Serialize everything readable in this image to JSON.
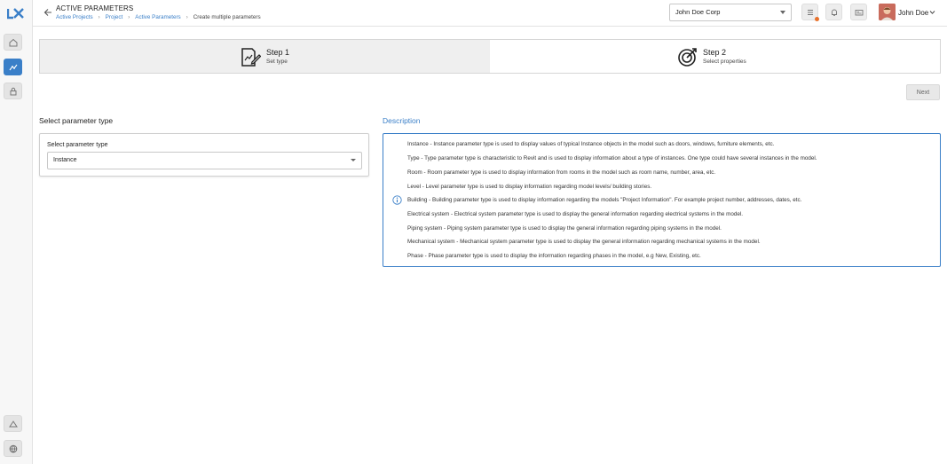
{
  "header": {
    "title": "ACTIVE PARAMETERS",
    "breadcrumb": [
      "Active Projects",
      "Project",
      "Active Parameters"
    ],
    "breadcrumb_current": "Create multiple parameters",
    "org_select_value": "John Doe Corp",
    "user_name": "John Doe"
  },
  "steps": [
    {
      "title": "Step 1",
      "subtitle": "Set type"
    },
    {
      "title": "Step 2",
      "subtitle": "Select properties"
    }
  ],
  "next_label": "Next",
  "left": {
    "section_title": "Select parameter type",
    "field_label": "Select parameter type",
    "selected_value": "Instance"
  },
  "description": {
    "title": "Description",
    "lines": [
      "Instance - Instance parameter type is used to display values of typical Instance objects in the model such as doors, windows, furniture elements, etc.",
      "Type - Type parameter type is characteristic to Revit and is used to display information about a type of instances. One type could have several instances in the model.",
      "Room - Room parameter type is used to display information from rooms in the model such as room name, number, area, etc.",
      "Level - Level parameter type is used to display information regarding model levels/ building stories.",
      "Building - Building parameter type is used to display information regarding the models \"Project Information\". For example project number, addresses, dates, etc.",
      "Electrical system - Electrical system parameter type is used to display the general information regarding electrical systems in the model.",
      "Piping system - Piping system parameter type is used to display the general information regarding piping systems in the model.",
      "Mechanical system - Mechanical system parameter type is used to display the general information regarding mechanical systems in the model.",
      "Phase - Phase parameter type is used to display the information regarding phases in the model, e.g New, Existing, etc."
    ]
  },
  "colors": {
    "accent": "#3a7fc8",
    "notification": "#e8702a"
  },
  "icons": {
    "sidebar": [
      "home-icon",
      "parameters-icon",
      "lock-icon",
      "upload-icon",
      "globe-icon"
    ],
    "header": [
      "back-arrow-icon",
      "list-icon",
      "bell-icon",
      "card-icon"
    ]
  }
}
